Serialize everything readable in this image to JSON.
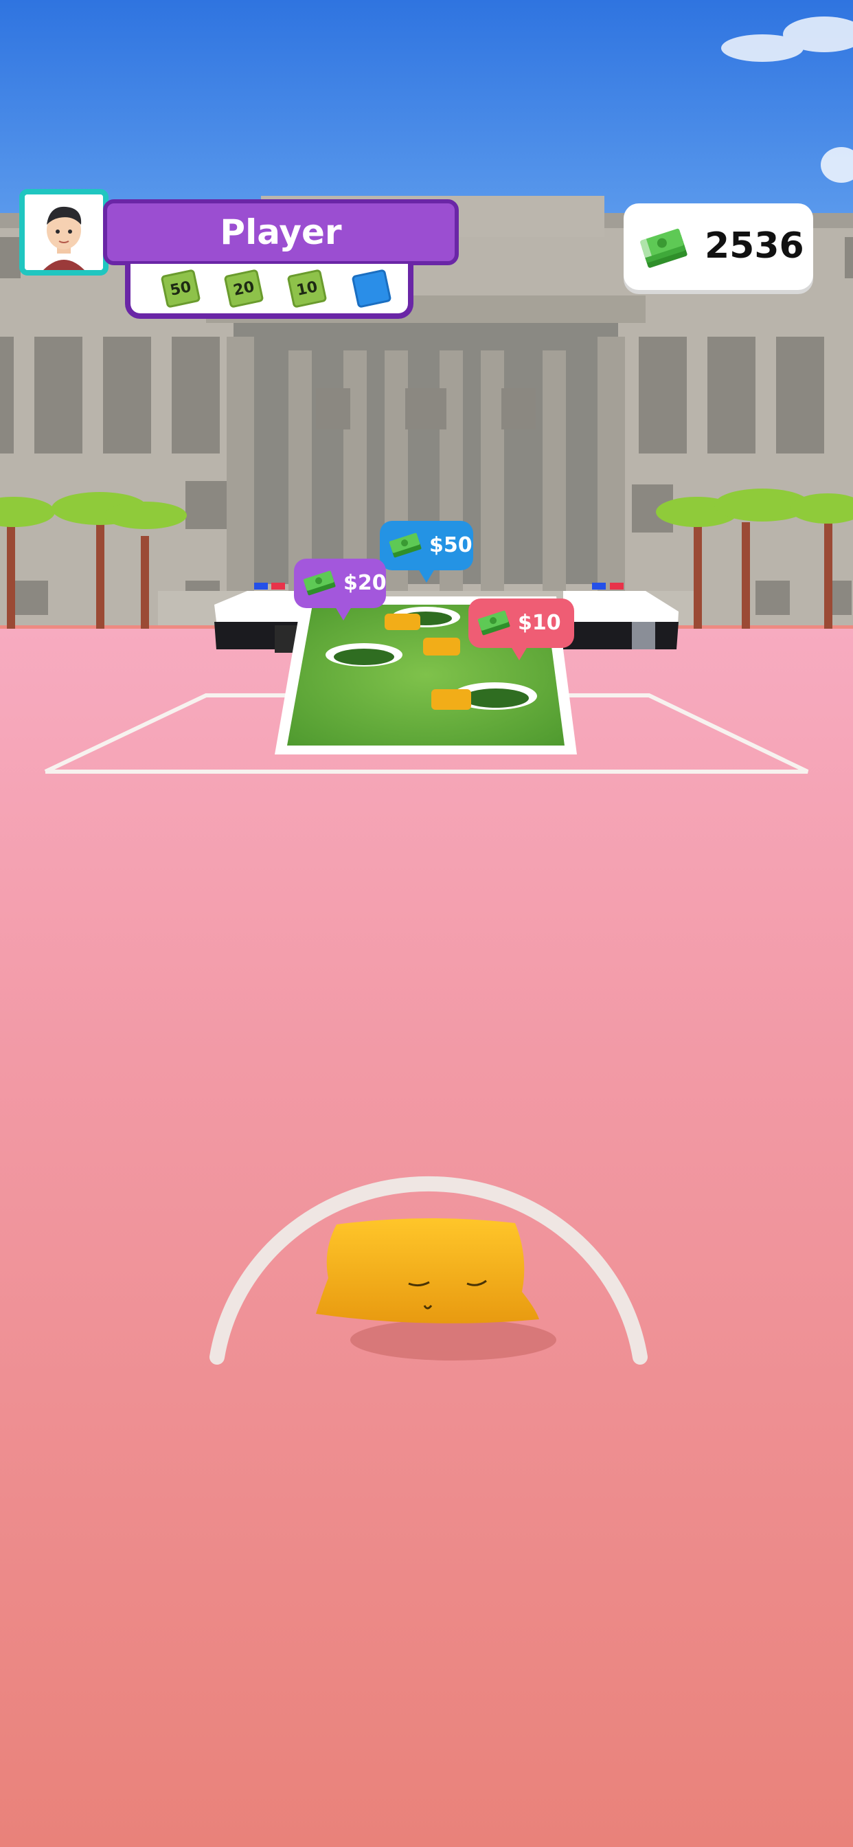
{
  "player": {
    "name": "Player",
    "tokens": [
      {
        "label": "50",
        "color": "green"
      },
      {
        "label": "20",
        "color": "green"
      },
      {
        "label": "10",
        "color": "green"
      },
      {
        "label": "",
        "color": "blue"
      }
    ]
  },
  "money": {
    "amount": "2536",
    "icon": "cash-stack-icon"
  },
  "targets": [
    {
      "label": "$50",
      "color": "#2493e4"
    },
    {
      "label": "$20",
      "color": "#a357dc"
    },
    {
      "label": "$10",
      "color": "#ef5d74"
    }
  ],
  "colors": {
    "sky": "#3b82e6",
    "ground": "#ee8a82",
    "board": "#6ab43d",
    "cornhole_bag": "#f7b51a",
    "accent_purple": "#9b4ed1",
    "accent_teal": "#20c6c0"
  }
}
